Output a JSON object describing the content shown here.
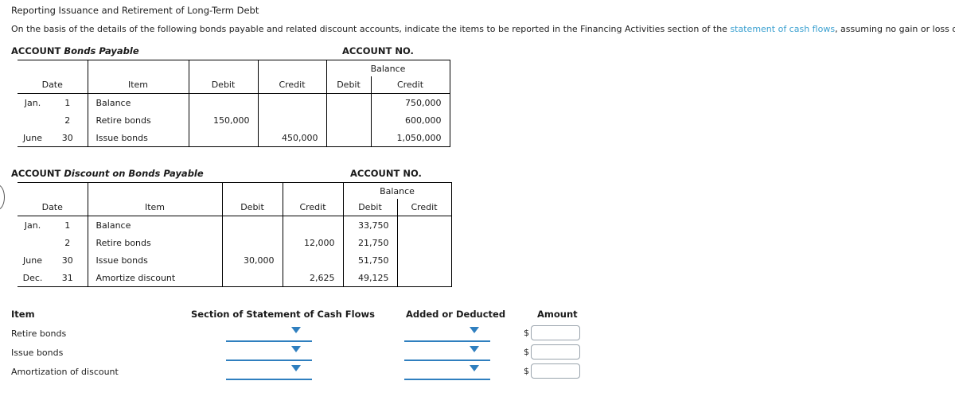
{
  "page": {
    "title": "Reporting Issuance and Retirement of Long-Term Debt",
    "instructions_pre": "On the basis of the details of the following bonds payable and related discount accounts, indicate the items to be reported in the Financing Activities section of the ",
    "instructions_link": "statement of cash flows",
    "instructions_post": ", assuming no gain or loss on retiring the bonds:"
  },
  "ledger1": {
    "account_label": "ACCOUNT",
    "account_name": "Bonds Payable",
    "account_no_label": "ACCOUNT NO.",
    "balance_label": "Balance",
    "columns": [
      "Date",
      "Item",
      "Debit",
      "Credit",
      "Debit",
      "Credit"
    ],
    "rows": [
      {
        "month": "Jan.",
        "day": "1",
        "item": "Balance",
        "debit": "",
        "credit": "",
        "bal_debit": "",
        "bal_credit": "750,000"
      },
      {
        "month": "",
        "day": "2",
        "item": "Retire bonds",
        "debit": "150,000",
        "credit": "",
        "bal_debit": "",
        "bal_credit": "600,000"
      },
      {
        "month": "June",
        "day": "30",
        "item": "Issue bonds",
        "debit": "",
        "credit": "450,000",
        "bal_debit": "",
        "bal_credit": "1,050,000"
      }
    ]
  },
  "ledger2": {
    "account_label": "ACCOUNT",
    "account_name": "Discount on Bonds Payable",
    "account_no_label": "ACCOUNT NO.",
    "balance_label": "Balance",
    "columns": [
      "Date",
      "Item",
      "Debit",
      "Credit",
      "Debit",
      "Credit"
    ],
    "rows": [
      {
        "month": "Jan.",
        "day": "1",
        "item": "Balance",
        "debit": "",
        "credit": "",
        "bal_debit": "33,750",
        "bal_credit": ""
      },
      {
        "month": "",
        "day": "2",
        "item": "Retire bonds",
        "debit": "",
        "credit": "12,000",
        "bal_debit": "21,750",
        "bal_credit": ""
      },
      {
        "month": "June",
        "day": "30",
        "item": "Issue bonds",
        "debit": "30,000",
        "credit": "",
        "bal_debit": "51,750",
        "bal_credit": ""
      },
      {
        "month": "Dec.",
        "day": "31",
        "item": "Amortize discount",
        "debit": "",
        "credit": "2,625",
        "bal_debit": "49,125",
        "bal_credit": ""
      }
    ]
  },
  "answers": {
    "headers": {
      "item": "Item",
      "section": "Section of Statement of Cash Flows",
      "added": "Added or Deducted",
      "amount": "Amount"
    },
    "currency_symbol": "$",
    "rows": [
      {
        "item": "Retire bonds",
        "section_value": "",
        "added_value": "",
        "amount_value": ""
      },
      {
        "item": "Issue bonds",
        "section_value": "",
        "added_value": "",
        "amount_value": ""
      },
      {
        "item": "Amortization of discount",
        "section_value": "",
        "added_value": "",
        "amount_value": ""
      }
    ]
  },
  "colors": {
    "link": "#3aa0d0",
    "control_blue": "#2f7fbf",
    "input_border": "#9aa4ad"
  }
}
